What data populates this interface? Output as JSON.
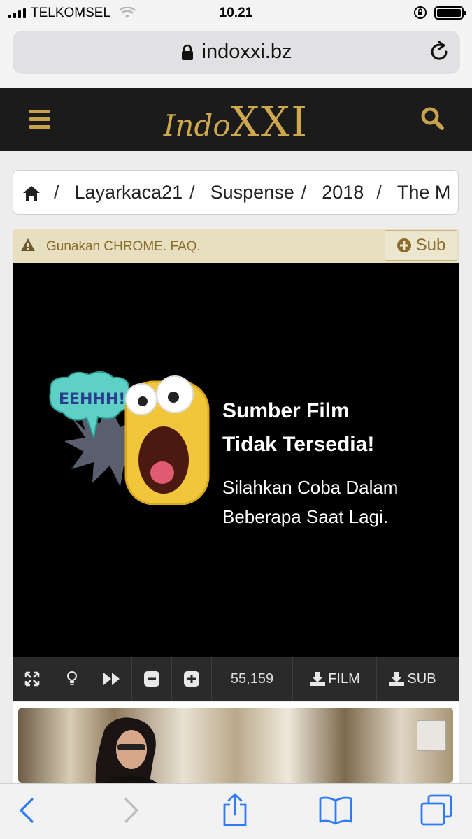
{
  "status_bar": {
    "carrier": "TELKOMSEL",
    "time": "10.21"
  },
  "url_bar": {
    "domain": "indoxxi.bz"
  },
  "site_header": {
    "logo_script": "Indo",
    "logo_main": "XXI",
    "brand_color": "#cfa84e"
  },
  "breadcrumb": {
    "items": [
      "Layarkaca21",
      "Suspense",
      "2018",
      "The M"
    ],
    "separator": "/"
  },
  "notice": {
    "text": "Gunakan CHROME. FAQ.",
    "sub_button_label": "Sub"
  },
  "player": {
    "bubble_text": "EEHHH!!",
    "error_title_line1": "Sumber Film",
    "error_title_line2": "Tidak Tersedia!",
    "error_sub_line1": "Silahkan Coba Dalam",
    "error_sub_line2": "Beberapa Saat Lagi."
  },
  "controls": {
    "view_count": "55,159",
    "download_film_label": "FILM",
    "download_sub_label": "SUB",
    "icons": [
      "fullscreen-icon",
      "lightbulb-icon",
      "fast-forward-icon",
      "zoom-out-icon",
      "zoom-in-icon",
      "download-icon"
    ]
  },
  "toolbar": {
    "icons": [
      "back-icon",
      "forward-icon",
      "share-icon",
      "bookmarks-icon",
      "tabs-icon"
    ]
  }
}
